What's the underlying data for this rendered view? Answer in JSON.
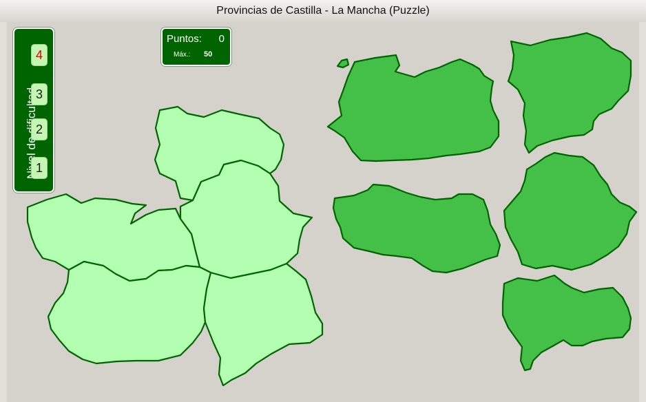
{
  "window": {
    "title": "Provincias de Castilla - La Mancha (Puzzle)"
  },
  "difficulty": {
    "label": "Nivel de dificultad",
    "levels": [
      "4",
      "3",
      "2",
      "1"
    ],
    "selected": "4"
  },
  "score": {
    "points_label": "Puntos:",
    "points_value": "0",
    "max_label": "Máx.:",
    "max_value": "50"
  },
  "colors": {
    "panel_bg": "#006500",
    "slot_fill": "#b3ffb1",
    "piece_fill": "#44bf48",
    "outline": "#006400",
    "selected_level_text": "#e00000",
    "background": "#d5d1cb"
  }
}
